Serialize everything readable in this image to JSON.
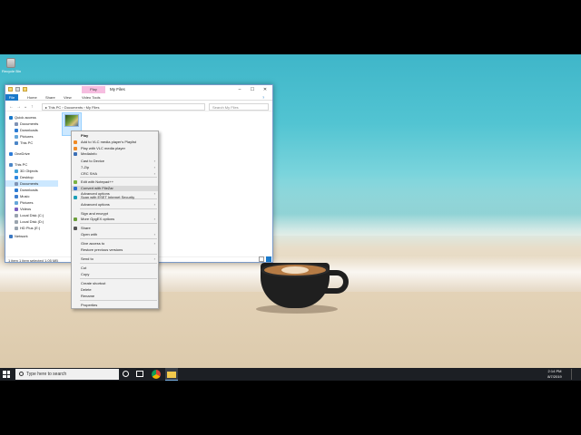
{
  "desktop": {
    "recycle_bin_label": "Recycle Bin"
  },
  "explorer": {
    "title": "My Files",
    "manage_tab": "Play",
    "tabs": [
      "File",
      "Home",
      "Share",
      "View",
      "Video Tools"
    ],
    "address_path": [
      "This PC",
      "Documents",
      "My Files"
    ],
    "search_placeholder": "Search My Files",
    "nav_items": [
      {
        "label": "Quick access",
        "icon_color": "#1979ca",
        "selected": false
      },
      {
        "label": "Documents",
        "icon_color": "#7f93b5",
        "selected": false
      },
      {
        "label": "Downloads",
        "icon_color": "#2b7bd4",
        "selected": false
      },
      {
        "label": "Pictures",
        "icon_color": "#66a7d9",
        "selected": false
      },
      {
        "label": "This PC",
        "icon_color": "#4b86c7",
        "selected": false
      },
      {
        "label": "OneDrive",
        "icon_color": "#2c7cd8",
        "selected": false
      },
      {
        "label": "This PC",
        "icon_color": "#4b86c7",
        "selected": false
      },
      {
        "label": "3D Objects",
        "icon_color": "#3da0d8",
        "selected": false
      },
      {
        "label": "Desktop",
        "icon_color": "#2f8ae0",
        "selected": false
      },
      {
        "label": "Documents",
        "icon_color": "#7f93b5",
        "selected": true
      },
      {
        "label": "Downloads",
        "icon_color": "#2b7bd4",
        "selected": false
      },
      {
        "label": "Music",
        "icon_color": "#3f7fcf",
        "selected": false
      },
      {
        "label": "Pictures",
        "icon_color": "#66a7d9",
        "selected": false
      },
      {
        "label": "Videos",
        "icon_color": "#7a5fc0",
        "selected": false
      },
      {
        "label": "Local Disk (C:)",
        "icon_color": "#9aa4ae",
        "selected": false
      },
      {
        "label": "Local Disk (D:)",
        "icon_color": "#9aa4ae",
        "selected": false
      },
      {
        "label": "HD Plus (E:)",
        "icon_color": "#9aa4ae",
        "selected": false
      },
      {
        "label": "Network",
        "icon_color": "#3b78c2",
        "selected": false
      }
    ],
    "status": "1 item    1 item selected  1.05 MB"
  },
  "context_menu": {
    "items": [
      {
        "label": "Play",
        "bold": true,
        "submenu": false,
        "icon_color": ""
      },
      {
        "label": "Add to VLC media player's Playlist",
        "bold": false,
        "submenu": false,
        "icon_color": "#f08a24"
      },
      {
        "label": "Play with VLC media player",
        "bold": false,
        "submenu": false,
        "icon_color": "#f08a24"
      },
      {
        "label": "MediaInfo",
        "bold": false,
        "submenu": false,
        "icon_color": "#3b6fb5"
      },
      {
        "label": "Cast to Device",
        "bold": false,
        "submenu": true,
        "icon_color": ""
      },
      {
        "label": "7-Zip",
        "bold": false,
        "submenu": true,
        "icon_color": ""
      },
      {
        "label": "CRC SHA",
        "bold": false,
        "submenu": true,
        "icon_color": ""
      },
      {
        "label": "Edit with Notepad++",
        "bold": false,
        "submenu": false,
        "icon_color": "#7cb342"
      },
      {
        "label": "Convert with FileZar",
        "bold": false,
        "submenu": false,
        "icon_color": "#2f6fd0"
      },
      {
        "label": "Advanced options",
        "bold": false,
        "submenu": true,
        "icon_color": ""
      },
      {
        "label": "Scan with ESET Internet Security",
        "bold": false,
        "submenu": false,
        "icon_color": "#1aa0b8"
      },
      {
        "label": "Advanced options",
        "bold": false,
        "submenu": true,
        "icon_color": ""
      },
      {
        "label": "Sign and encrypt",
        "bold": false,
        "submenu": false,
        "icon_color": ""
      },
      {
        "label": "More GpgEX options",
        "bold": false,
        "submenu": true,
        "icon_color": "#6b9d3a"
      },
      {
        "label": "Share",
        "bold": false,
        "submenu": false,
        "icon_color": "#555555"
      },
      {
        "label": "Open with",
        "bold": false,
        "submenu": true,
        "icon_color": ""
      },
      {
        "label": "Give access to",
        "bold": false,
        "submenu": true,
        "icon_color": ""
      },
      {
        "label": "Restore previous versions",
        "bold": false,
        "submenu": false,
        "icon_color": ""
      },
      {
        "label": "Send to",
        "bold": false,
        "submenu": true,
        "icon_color": ""
      },
      {
        "label": "Cut",
        "bold": false,
        "submenu": false,
        "icon_color": ""
      },
      {
        "label": "Copy",
        "bold": false,
        "submenu": false,
        "icon_color": ""
      },
      {
        "label": "Create shortcut",
        "bold": false,
        "submenu": false,
        "icon_color": ""
      },
      {
        "label": "Delete",
        "bold": false,
        "submenu": false,
        "icon_color": ""
      },
      {
        "label": "Rename",
        "bold": false,
        "submenu": false,
        "icon_color": ""
      },
      {
        "label": "Properties",
        "bold": false,
        "submenu": false,
        "icon_color": ""
      }
    ],
    "highlighted_item": "Convert with FileZar"
  },
  "taskbar": {
    "search_placeholder": "Type here to search",
    "time": "2:14 PM",
    "date": "8/7/2019"
  }
}
